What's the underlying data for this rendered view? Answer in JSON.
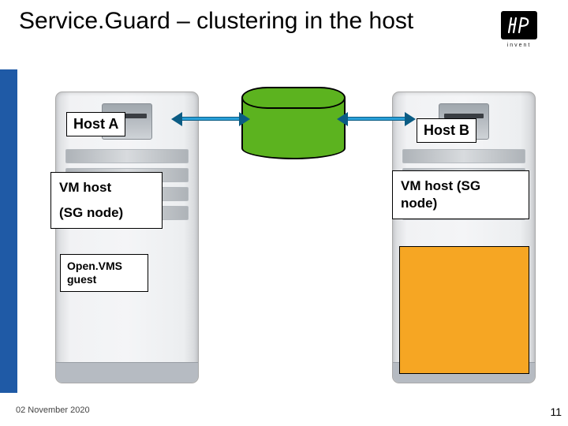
{
  "title": "Service.Guard – clustering in the host",
  "logo": {
    "caption": "invent"
  },
  "hosts": {
    "a": {
      "label": "Host A",
      "vm_line1": "VM host",
      "vm_line2": "(SG node)",
      "guest": "Open.VMS guest"
    },
    "b": {
      "label": "Host B",
      "vm": "VM host  (SG node)"
    }
  },
  "footer": {
    "date": "02 November 2020",
    "page": "11"
  }
}
